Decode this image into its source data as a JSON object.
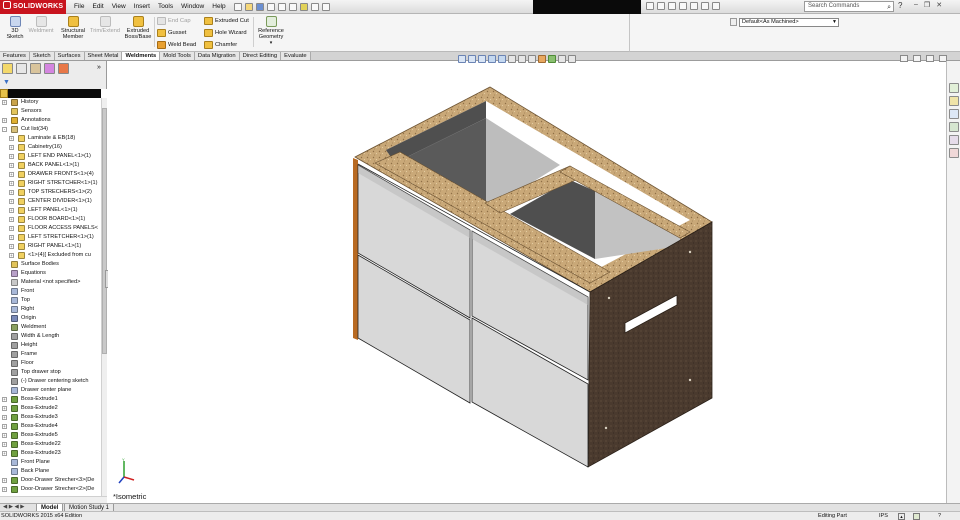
{
  "app": {
    "logo": "SOLIDWORKS",
    "menus": [
      "File",
      "Edit",
      "View",
      "Insert",
      "Tools",
      "Window",
      "Help"
    ],
    "search_placeholder": "Search Commands"
  },
  "command_manager": {
    "big_buttons": [
      {
        "label": "3D Sketch",
        "enabled": true
      },
      {
        "label": "Weldment",
        "enabled": false
      },
      {
        "label": "Structural Member",
        "enabled": true
      },
      {
        "label": "Trim/Extend",
        "enabled": false
      },
      {
        "label": "Extruded Boss/Base",
        "enabled": true
      }
    ],
    "col1": [
      {
        "label": "End Cap",
        "enabled": false
      },
      {
        "label": "Gusset",
        "enabled": true
      },
      {
        "label": "Weld Bead",
        "enabled": true
      }
    ],
    "col2": [
      {
        "label": "Extruded Cut",
        "enabled": true
      },
      {
        "label": "Hole Wizard",
        "enabled": true
      },
      {
        "label": "Chamfer",
        "enabled": true
      }
    ],
    "ref_geometry": "Reference Geometry",
    "configuration": "Default<As Machined>"
  },
  "tabs": [
    "Features",
    "Sketch",
    "Surfaces",
    "Sheet Metal",
    "Weldments",
    "Mold Tools",
    "Data Migration",
    "Direct Editing",
    "Evaluate"
  ],
  "active_tab": "Weldments",
  "feature_tree": [
    {
      "label": "History",
      "level": 0,
      "expander": "+",
      "icon": "history-icon",
      "color": "#c9a34a"
    },
    {
      "label": "Sensors",
      "level": 0,
      "expander": "",
      "icon": "sensor-icon",
      "color": "#e2c45a"
    },
    {
      "label": "Annotations",
      "level": 0,
      "expander": "+",
      "icon": "annotation-icon",
      "color": "#e0b030"
    },
    {
      "label": "Cut list(34)",
      "level": 0,
      "expander": "-",
      "icon": "cut-list-icon",
      "color": "#d8c07a"
    },
    {
      "label": "Laminate & EB(18)",
      "level": 1,
      "expander": "+",
      "icon": "folder-icon",
      "color": "#f0d060"
    },
    {
      "label": "Cabinetry(16)",
      "level": 1,
      "expander": "+",
      "icon": "folder-icon",
      "color": "#f0d060"
    },
    {
      "label": "LEFT END PANEL<1>(1)",
      "level": 1,
      "expander": "+",
      "icon": "folder-icon",
      "color": "#f0d060"
    },
    {
      "label": "BACK PANEL<1>(1)",
      "level": 1,
      "expander": "+",
      "icon": "folder-icon",
      "color": "#f0d060"
    },
    {
      "label": "DRAWER FRONTS<1>(4)",
      "level": 1,
      "expander": "+",
      "icon": "folder-icon",
      "color": "#f0d060"
    },
    {
      "label": "RIGHT STRETCHER<1>(1)",
      "level": 1,
      "expander": "+",
      "icon": "folder-icon",
      "color": "#f0d060"
    },
    {
      "label": "TOP STRECHERS<1>(2)",
      "level": 1,
      "expander": "+",
      "icon": "folder-icon",
      "color": "#f0d060"
    },
    {
      "label": "CENTER DIVIDER<1>(1)",
      "level": 1,
      "expander": "+",
      "icon": "folder-icon",
      "color": "#f0d060"
    },
    {
      "label": "LEFT PANEL<1>(1)",
      "level": 1,
      "expander": "+",
      "icon": "folder-icon",
      "color": "#f0d060"
    },
    {
      "label": "FLOOR BOARD<1>(1)",
      "level": 1,
      "expander": "+",
      "icon": "folder-icon",
      "color": "#f0d060"
    },
    {
      "label": "FLOOR ACCESS PANELS<",
      "level": 1,
      "expander": "+",
      "icon": "folder-icon",
      "color": "#f0d060"
    },
    {
      "label": "LEFT STRETCHER<1>(1)",
      "level": 1,
      "expander": "+",
      "icon": "folder-icon",
      "color": "#f0d060"
    },
    {
      "label": "RIGHT PANEL<1>(1)",
      "level": 1,
      "expander": "+",
      "icon": "folder-icon",
      "color": "#f0d060"
    },
    {
      "label": "<1>(4)[ Excluded from cu",
      "level": 1,
      "expander": "+",
      "icon": "excluded-folder-icon",
      "color": "#f0d060"
    },
    {
      "label": "Surface Bodies",
      "level": 0,
      "expander": "",
      "icon": "surface-bodies-icon",
      "color": "#e2c45a"
    },
    {
      "label": "Equations",
      "level": 0,
      "expander": "",
      "icon": "equations-icon",
      "color": "#b8a0c8"
    },
    {
      "label": "Material <not specified>",
      "level": 0,
      "expander": "",
      "icon": "material-icon",
      "color": "#c8c8c8"
    },
    {
      "label": "Front",
      "level": 0,
      "expander": "",
      "icon": "plane-icon",
      "color": "#a8b8d8"
    },
    {
      "label": "Top",
      "level": 0,
      "expander": "",
      "icon": "plane-icon",
      "color": "#a8b8d8"
    },
    {
      "label": "Right",
      "level": 0,
      "expander": "",
      "icon": "plane-icon",
      "color": "#a8b8d8"
    },
    {
      "label": "Origin",
      "level": 0,
      "expander": "",
      "icon": "origin-icon",
      "color": "#7a8ab8"
    },
    {
      "label": "Weldment",
      "level": 0,
      "expander": "",
      "icon": "weldment-icon",
      "color": "#8aa060"
    },
    {
      "label": "Width & Length",
      "level": 0,
      "expander": "",
      "icon": "sketch-icon",
      "color": "#a0a0a0"
    },
    {
      "label": "Height",
      "level": 0,
      "expander": "",
      "icon": "sketch-icon",
      "color": "#a0a0a0"
    },
    {
      "label": "Frame",
      "level": 0,
      "expander": "",
      "icon": "sketch-icon",
      "color": "#a0a0a0"
    },
    {
      "label": "Floor",
      "level": 0,
      "expander": "",
      "icon": "sketch-icon",
      "color": "#a0a0a0"
    },
    {
      "label": "Top drawer stop",
      "level": 0,
      "expander": "",
      "icon": "sketch-icon",
      "color": "#a0a0a0"
    },
    {
      "label": "(-) Drawer centering sketch",
      "level": 0,
      "expander": "",
      "icon": "sketch-icon",
      "color": "#a0a0a0"
    },
    {
      "label": "Drawer center plane",
      "level": 0,
      "expander": "",
      "icon": "plane-icon",
      "color": "#a8b8d8"
    },
    {
      "label": "Boss-Extrude1",
      "level": 0,
      "expander": "+",
      "icon": "extrude-icon",
      "color": "#70a040"
    },
    {
      "label": "Boss-Extrude2",
      "level": 0,
      "expander": "+",
      "icon": "extrude-icon",
      "color": "#70a040"
    },
    {
      "label": "Boss-Extrude3",
      "level": 0,
      "expander": "+",
      "icon": "extrude-icon",
      "color": "#70a040"
    },
    {
      "label": "Boss-Extrude4",
      "level": 0,
      "expander": "+",
      "icon": "extrude-icon",
      "color": "#70a040"
    },
    {
      "label": "Boss-Extrude5",
      "level": 0,
      "expander": "+",
      "icon": "extrude-icon",
      "color": "#70a040"
    },
    {
      "label": "Boss-Extrude22",
      "level": 0,
      "expander": "+",
      "icon": "extrude-icon",
      "color": "#70a040"
    },
    {
      "label": "Boss-Extrude23",
      "level": 0,
      "expander": "+",
      "icon": "extrude-icon",
      "color": "#70a040"
    },
    {
      "label": "Front Plane",
      "level": 0,
      "expander": "",
      "icon": "plane-icon",
      "color": "#a8b8d8"
    },
    {
      "label": "Back Plane",
      "level": 0,
      "expander": "",
      "icon": "plane-icon",
      "color": "#a8b8d8"
    },
    {
      "label": "Door-Drawer Strecher<3>(De",
      "level": 0,
      "expander": "+",
      "icon": "structural-member-icon",
      "color": "#70a040"
    },
    {
      "label": "Door-Drawer Strecher<2>(De",
      "level": 0,
      "expander": "+",
      "icon": "structural-member-icon",
      "color": "#70a040"
    }
  ],
  "viewport": {
    "view_name": "*Isometric",
    "colors": {
      "particleboard": "#c9a878",
      "end_panel": "#4a3a2e",
      "laminate_front": "#d8d8d8",
      "interior": "#5a5a5a",
      "edge_band": "#b86a22"
    }
  },
  "bottom_tabs": {
    "nav": "◀ ▶ ◀ ▶",
    "model": "Model",
    "motion": "Motion Study 1"
  },
  "status": {
    "left": "SOLIDWORKS 2015 x64 Edition",
    "editing": "Editing Part",
    "units": "IPS",
    "units_arrow": "▲",
    "help": "?"
  }
}
